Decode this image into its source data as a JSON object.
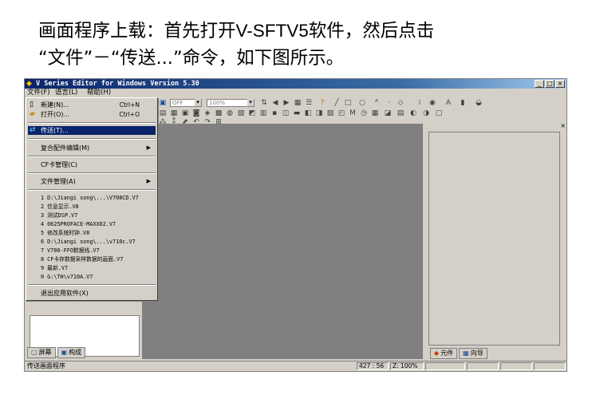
{
  "caption": {
    "line1_a": "画面程序上载：首先打开",
    "line1_b": "V-SFTV5",
    "line1_c": "软件，然后点击",
    "line2_a": "“文件”",
    "line2_b": "－",
    "line2_c": "“传送...”",
    "line2_d": "命令，如下图所示。"
  },
  "window": {
    "title": "V Series Editor for Windows Version 5.30",
    "controls": [
      "_",
      "□",
      "×"
    ]
  },
  "menubar": [
    "文件(F)",
    "语言(L)",
    "帮助(H)"
  ],
  "toolbar": {
    "combo1": "OFF",
    "combo2": "100%"
  },
  "file_menu": {
    "items": [
      {
        "label": "新建(N)...",
        "shortcut": "Ctrl+N",
        "icon": "new-file-icon"
      },
      {
        "label": "打开(O)...",
        "shortcut": "Ctrl+O",
        "icon": "open-folder-icon"
      },
      {
        "label": "传送(T)...",
        "selected": true,
        "icon": "transfer-icon"
      },
      {
        "label": "复合配件编辑(M)",
        "submenu": true
      },
      {
        "label": "CF卡管理(C)"
      },
      {
        "label": "文件管理(A)",
        "submenu": true
      }
    ],
    "recent": [
      "1 D:\\Jiangi song\\...\\V708CD.V7",
      "2 信息显示.V8",
      "3 测试DSP.V7",
      "4 0625PROFACE-MAXX02.V7",
      "5 修改系统时钟.V8",
      "6 D:\\Jiangi song\\...\\v710c.V7",
      "7 V706-FFO数据线.V7",
      "8 CF卡存数据采样数据的画面.V7",
      "9 最新.V7",
      "0 G:\\TH\\v710A.V7"
    ],
    "exit": "退出应用软件(X)"
  },
  "left_tabs": [
    "屏幕",
    "构成"
  ],
  "right_tabs": [
    "元件",
    "向导"
  ],
  "statusbar": {
    "text": "传送画面程序",
    "coords": "427 : 56",
    "zoom": "Z: 100%"
  }
}
